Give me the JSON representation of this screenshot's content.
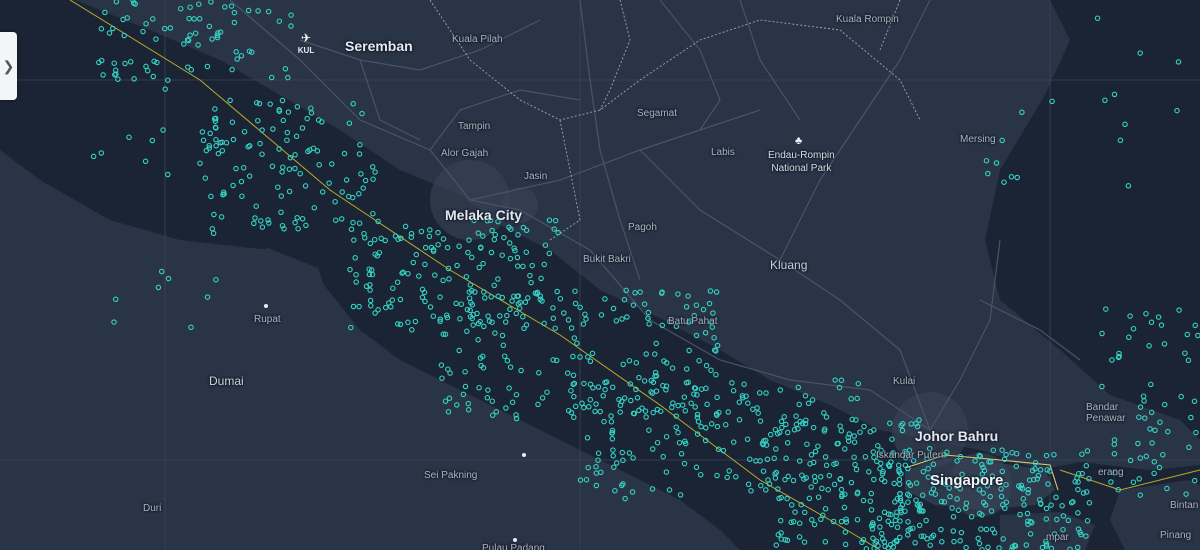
{
  "map": {
    "places": [
      {
        "id": "seremban",
        "name": "Seremban",
        "cls": "major"
      },
      {
        "id": "kuala-pilah",
        "name": "Kuala Pilah",
        "cls": "small"
      },
      {
        "id": "kuala-rompin",
        "name": "Kuala Rompin",
        "cls": "small"
      },
      {
        "id": "tampin",
        "name": "Tampin",
        "cls": "small"
      },
      {
        "id": "alor-gajah",
        "name": "Alor Gajah",
        "cls": "small"
      },
      {
        "id": "jasin",
        "name": "Jasin",
        "cls": "small"
      },
      {
        "id": "segamat",
        "name": "Segamat",
        "cls": "small"
      },
      {
        "id": "labis",
        "name": "Labis",
        "cls": "small"
      },
      {
        "id": "mersing",
        "name": "Mersing",
        "cls": "small"
      },
      {
        "id": "melaka-city",
        "name": "Melaka City",
        "cls": "major"
      },
      {
        "id": "pagoh",
        "name": "Pagoh",
        "cls": "small"
      },
      {
        "id": "bukit-bakri",
        "name": "Bukit Bakri",
        "cls": "small"
      },
      {
        "id": "kluang",
        "name": "Kluang",
        "cls": "mid"
      },
      {
        "id": "rupat",
        "name": "Rupat",
        "cls": "small"
      },
      {
        "id": "batu-pahat",
        "name": "Batu Pahat",
        "cls": "small"
      },
      {
        "id": "dumai",
        "name": "Dumai",
        "cls": "mid"
      },
      {
        "id": "kulai",
        "name": "Kulai",
        "cls": "small"
      },
      {
        "id": "johor-bahru",
        "name": "Johor Bahru",
        "cls": "major"
      },
      {
        "id": "iskandar-puteri",
        "name": "Iskandar Puteri",
        "cls": "small"
      },
      {
        "id": "singapore",
        "name": "Singapore",
        "cls": "big"
      },
      {
        "id": "sei-pakning",
        "name": "Sei Pakning",
        "cls": "small"
      },
      {
        "id": "duri",
        "name": "Duri",
        "cls": "small"
      },
      {
        "id": "pulau-padang",
        "name": "Pulau Padang",
        "cls": "small"
      },
      {
        "id": "bandar-penawar",
        "name": "Bandar\nPenawar",
        "cls": "small"
      },
      {
        "id": "pengerang",
        "name": "erang",
        "cls": "small"
      },
      {
        "id": "tanjung-pinang",
        "name": "Pinang",
        "cls": "small"
      },
      {
        "id": "bintan",
        "name": "Bintan",
        "cls": "small"
      },
      {
        "id": "mpar",
        "name": "mpar",
        "cls": "small"
      }
    ],
    "park": {
      "name": "Endau-Rompin\nNational Park",
      "icon": "park-icon"
    },
    "airport": {
      "code": "KUL",
      "icon": "airplane-icon"
    },
    "panel_toggle": {
      "glyph": "❯",
      "icon": "chevron-right-icon"
    },
    "colors": {
      "land": "#2a3447",
      "sea": "#1b2434",
      "road": "#4a5467",
      "border": "#c7ccd6",
      "vessel": "#35d3c6",
      "route": "#b9ad2a",
      "urban": "#3a4457"
    }
  }
}
